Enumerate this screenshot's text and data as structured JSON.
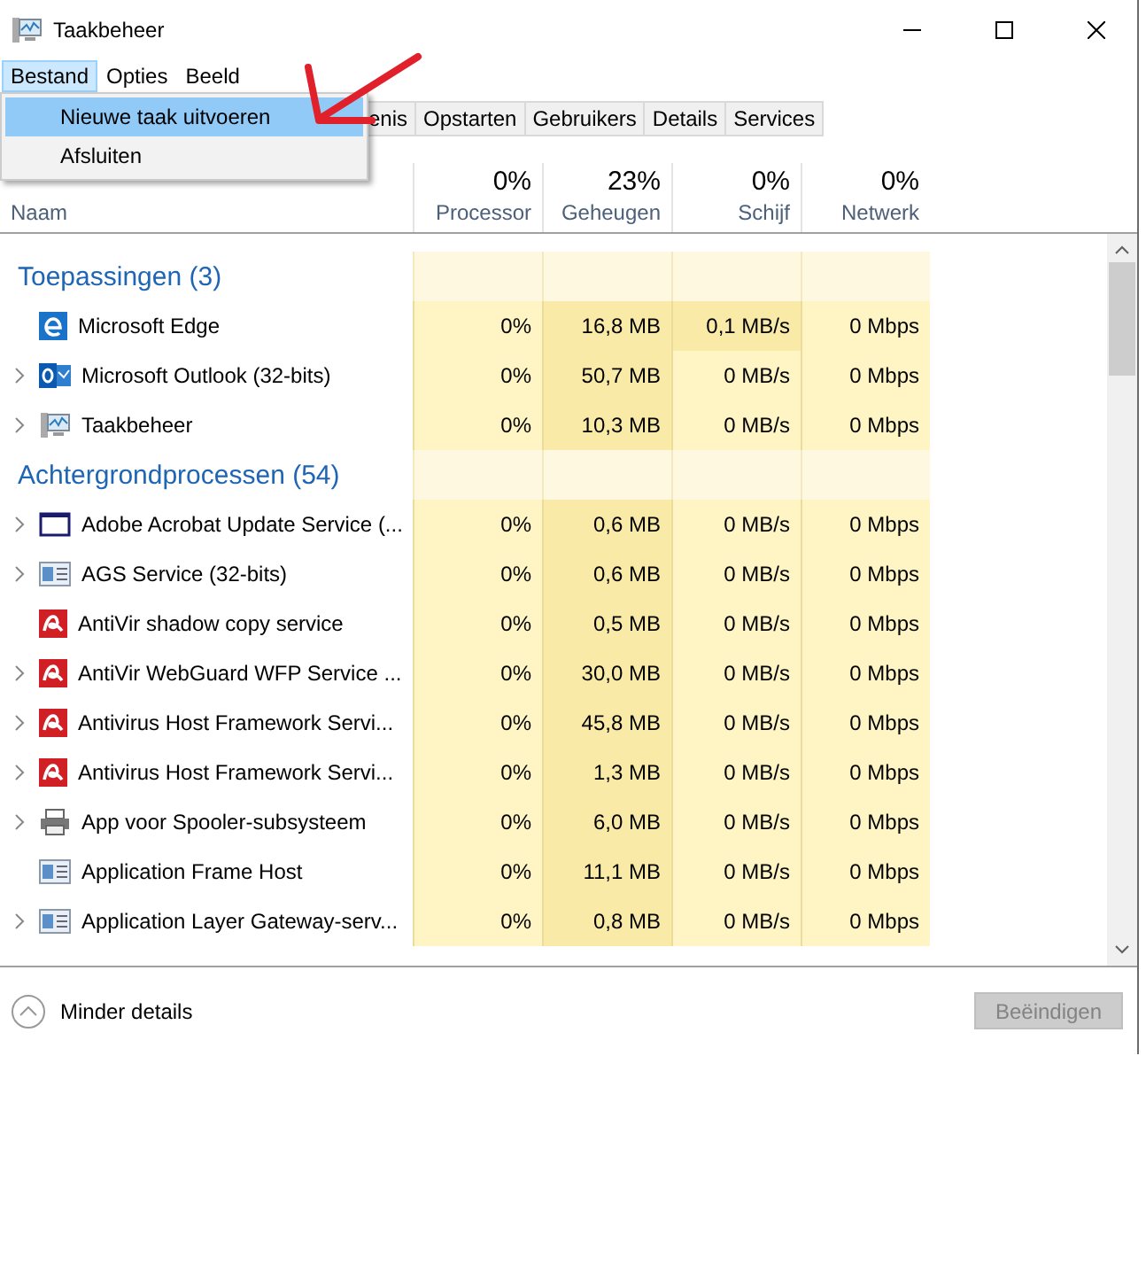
{
  "window": {
    "title": "Taakbeheer"
  },
  "menu": [
    {
      "label": "Bestand",
      "selected": true
    },
    {
      "label": "Opties",
      "selected": false
    },
    {
      "label": "Beeld",
      "selected": false
    }
  ],
  "dropdown": [
    {
      "label": "Nieuwe taak uitvoeren",
      "selected": true
    },
    {
      "label": "Afsluiten",
      "selected": false
    }
  ],
  "tabs": [
    {
      "label": "enis",
      "selected": false
    },
    {
      "label": "Opstarten",
      "selected": false
    },
    {
      "label": "Gebruikers",
      "selected": false
    },
    {
      "label": "Details",
      "selected": false
    },
    {
      "label": "Services",
      "selected": false
    }
  ],
  "table": {
    "name_column": "Naam",
    "columns": [
      {
        "total": "0%",
        "label": "Processor"
      },
      {
        "total": "23%",
        "label": "Geheugen"
      },
      {
        "total": "0%",
        "label": "Schijf"
      },
      {
        "total": "0%",
        "label": "Netwerk"
      }
    ],
    "groups": [
      {
        "title": "Toepassingen (3)",
        "rows": [
          {
            "name": "Microsoft Edge",
            "kind": "edge",
            "expandable": false,
            "cells": [
              "0%",
              "16,8 MB",
              "0,1 MB/s",
              "0 Mbps"
            ]
          },
          {
            "name": "Microsoft Outlook (32-bits)",
            "kind": "outlook",
            "expandable": true,
            "cells": [
              "0%",
              "50,7 MB",
              "0 MB/s",
              "0 Mbps"
            ]
          },
          {
            "name": "Taakbeheer",
            "kind": "monitor",
            "expandable": true,
            "cells": [
              "0%",
              "10,3 MB",
              "0 MB/s",
              "0 Mbps"
            ]
          }
        ]
      },
      {
        "title": "Achtergrondprocessen (54)",
        "rows": [
          {
            "name": "Adobe Acrobat Update Service (...",
            "kind": "window",
            "expandable": true,
            "cells": [
              "0%",
              "0,6 MB",
              "0 MB/s",
              "0 Mbps"
            ]
          },
          {
            "name": "AGS Service (32-bits)",
            "kind": "service",
            "expandable": true,
            "cells": [
              "0%",
              "0,6 MB",
              "0 MB/s",
              "0 Mbps"
            ]
          },
          {
            "name": "AntiVir shadow copy service",
            "kind": "avira",
            "expandable": false,
            "cells": [
              "0%",
              "0,5 MB",
              "0 MB/s",
              "0 Mbps"
            ]
          },
          {
            "name": "AntiVir WebGuard WFP Service ...",
            "kind": "avira",
            "expandable": true,
            "cells": [
              "0%",
              "30,0 MB",
              "0 MB/s",
              "0 Mbps"
            ]
          },
          {
            "name": "Antivirus Host Framework Servi...",
            "kind": "avira",
            "expandable": true,
            "cells": [
              "0%",
              "45,8 MB",
              "0 MB/s",
              "0 Mbps"
            ]
          },
          {
            "name": "Antivirus Host Framework Servi...",
            "kind": "avira",
            "expandable": true,
            "cells": [
              "0%",
              "1,3 MB",
              "0 MB/s",
              "0 Mbps"
            ]
          },
          {
            "name": "App voor Spooler-subsysteem",
            "kind": "printer",
            "expandable": true,
            "cells": [
              "0%",
              "6,0 MB",
              "0 MB/s",
              "0 Mbps"
            ]
          },
          {
            "name": "Application Frame Host",
            "kind": "service",
            "expandable": false,
            "cells": [
              "0%",
              "11,1 MB",
              "0 MB/s",
              "0 Mbps"
            ]
          },
          {
            "name": "Application Layer Gateway-serv...",
            "kind": "service",
            "expandable": true,
            "cells": [
              "0%",
              "0,8 MB",
              "0 MB/s",
              "0 Mbps"
            ]
          }
        ]
      }
    ]
  },
  "footer": {
    "toggle": "Minder details",
    "button": {
      "label": "Beëindigen",
      "disabled": true
    }
  }
}
